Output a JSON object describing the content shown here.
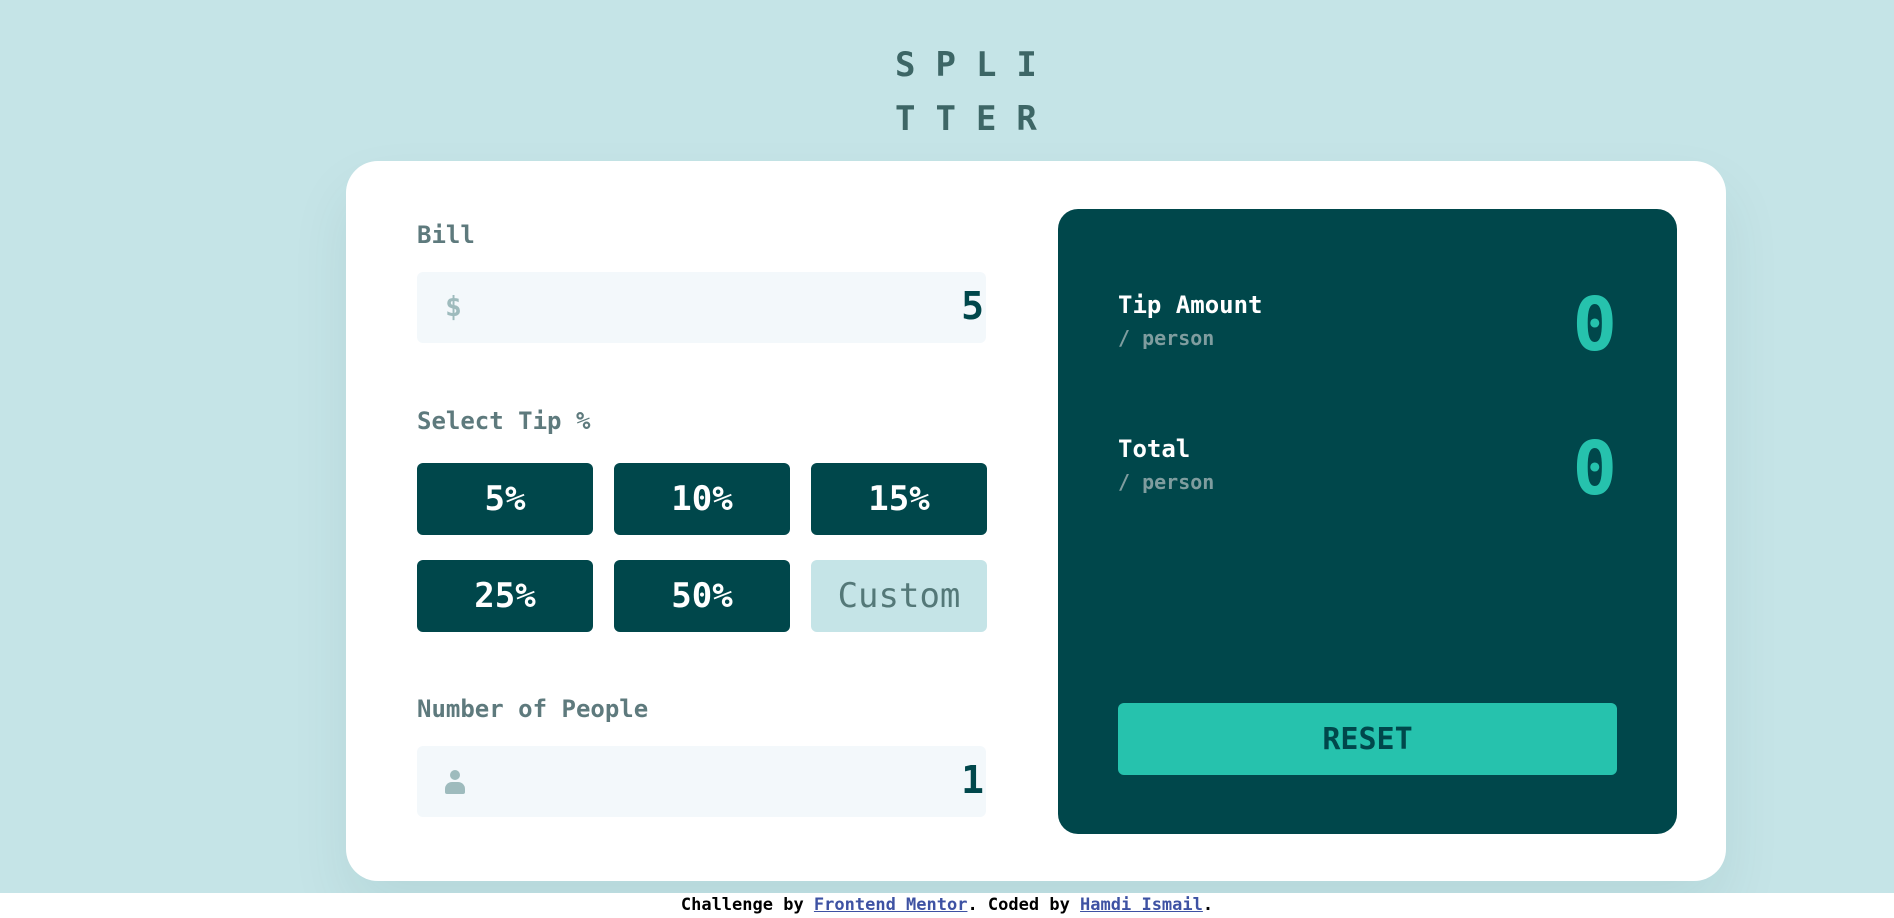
{
  "app": {
    "logo": "SPLI\nTTER"
  },
  "bill": {
    "label": "Bill",
    "prefix": "$",
    "value": "5"
  },
  "tip": {
    "label": "Select Tip %",
    "options": [
      "5%",
      "10%",
      "15%",
      "25%",
      "50%"
    ],
    "custom_placeholder": "Custom"
  },
  "people": {
    "label": "Number of People",
    "value": "1"
  },
  "results": {
    "tip_amount_label": "Tip Amount",
    "per_person": "/ person",
    "tip_amount_value": "0",
    "total_label": "Total",
    "total_value": "0",
    "reset_label": "RESET"
  },
  "footer": {
    "prefix": "Challenge by ",
    "challenge_link": "Frontend Mentor",
    "middle": ". Coded by ",
    "author_link": "Hamdi Ismail",
    "suffix": "."
  },
  "colors": {
    "background": "#c5e4e7",
    "dark_green": "#00474b",
    "strong_cyan": "#26c2ad",
    "white": "#ffffff"
  }
}
